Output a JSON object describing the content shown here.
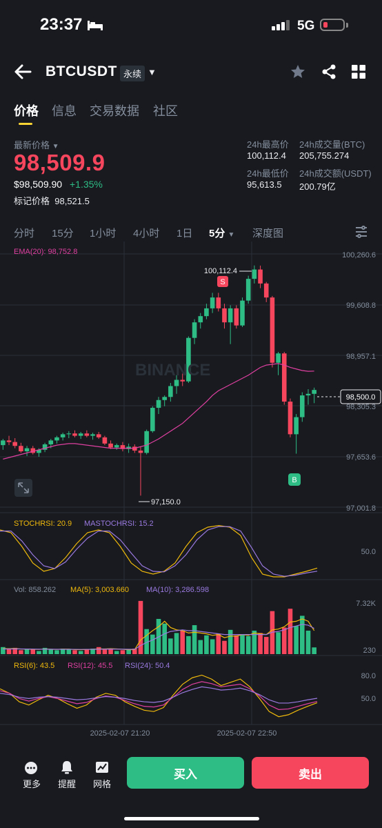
{
  "status_bar": {
    "time": "23:37",
    "network": "5G"
  },
  "header": {
    "symbol": "BTCUSDT",
    "badge": "永续"
  },
  "tabs": [
    "价格",
    "信息",
    "交易数据",
    "社区"
  ],
  "price_panel": {
    "latest_label": "最新价格",
    "last_price": "98,509.9",
    "usd_price": "$98,509.90",
    "change_pct": "+1.35%",
    "mark_label": "标记价格",
    "mark_price": "98,521.5",
    "stats": {
      "high_label": "24h最高价",
      "high_value": "100,112.4",
      "vol_btc_label": "24h成交量(BTC)",
      "vol_btc_value": "205,755.274",
      "low_label": "24h最低价",
      "low_value": "95,613.5",
      "vol_usdt_label": "24h成交额(USDT)",
      "vol_usdt_value": "200.79亿"
    }
  },
  "timeframes": [
    "分时",
    "15分",
    "1小时",
    "4小时",
    "1日",
    "5分",
    "深度图"
  ],
  "active_timeframe": "5分",
  "colors": {
    "up": "#2ebd85",
    "down": "#f6465d",
    "accent": "#fcd535",
    "ema": "#e040a0",
    "purple": "#9b7ae0",
    "yellow": "#f0b90b"
  },
  "chart_data": [
    {
      "type": "candlestick",
      "title": "EMA(20): 98,752.8",
      "watermark": "BINANCE",
      "y_axis_labels": [
        "100,260.6",
        "99,608.8",
        "98,957.1",
        "98,305.3",
        "97,653.6",
        "97,001.8"
      ],
      "ylim": [
        97001.8,
        100260.6
      ],
      "current_price_label": "98,500.0",
      "high_annotation": "100,112.4",
      "low_annotation": "97,150.0",
      "sell_marker": "S",
      "buy_marker": "B",
      "candles": [
        [
          97800,
          97880,
          97740,
          97860
        ],
        [
          97860,
          97920,
          97800,
          97840
        ],
        [
          97840,
          97890,
          97760,
          97790
        ],
        [
          97790,
          97830,
          97700,
          97720
        ],
        [
          97720,
          97790,
          97660,
          97760
        ],
        [
          97760,
          97790,
          97680,
          97700
        ],
        [
          97700,
          97760,
          97650,
          97740
        ],
        [
          97740,
          97830,
          97710,
          97810
        ],
        [
          97810,
          97880,
          97760,
          97860
        ],
        [
          97860,
          97920,
          97820,
          97900
        ],
        [
          97900,
          97960,
          97860,
          97940
        ],
        [
          97940,
          97980,
          97890,
          97950
        ],
        [
          97950,
          97990,
          97900,
          97920
        ],
        [
          97920,
          97970,
          97880,
          97950
        ],
        [
          97950,
          97990,
          97900,
          97920
        ],
        [
          97920,
          97960,
          97870,
          97940
        ],
        [
          97940,
          97970,
          97880,
          97900
        ],
        [
          97900,
          97920,
          97800,
          97820
        ],
        [
          97820,
          97860,
          97750,
          97770
        ],
        [
          97770,
          97820,
          97740,
          97800
        ],
        [
          97800,
          97840,
          97720,
          97750
        ],
        [
          97750,
          97820,
          97700,
          97780
        ],
        [
          97780,
          97810,
          97700,
          97730
        ],
        [
          97730,
          97780,
          97150,
          97700
        ],
        [
          97700,
          98000,
          97680,
          97980
        ],
        [
          97980,
          98300,
          97960,
          98280
        ],
        [
          98280,
          98420,
          98200,
          98380
        ],
        [
          98380,
          98440,
          98300,
          98420
        ],
        [
          98420,
          98600,
          98360,
          98560
        ],
        [
          98560,
          98700,
          98460,
          98640
        ],
        [
          98640,
          98720,
          98560,
          98620
        ],
        [
          98620,
          99200,
          98600,
          99180
        ],
        [
          99180,
          99420,
          99100,
          99380
        ],
        [
          99380,
          99500,
          99300,
          99460
        ],
        [
          99460,
          99620,
          99420,
          99560
        ],
        [
          99560,
          99760,
          99500,
          99700
        ],
        [
          99700,
          99760,
          99520,
          99560
        ],
        [
          99560,
          99620,
          99300,
          99380
        ],
        [
          99380,
          99600,
          99100,
          99560
        ],
        [
          99560,
          99600,
          99300,
          99340
        ],
        [
          99340,
          99700,
          99320,
          99660
        ],
        [
          99660,
          99980,
          99620,
          99940
        ],
        [
          99940,
          100112.4,
          99880,
          100060
        ],
        [
          100060,
          100110,
          99820,
          99880
        ],
        [
          99880,
          99900,
          99640,
          99700
        ],
        [
          99700,
          99720,
          98800,
          98860
        ],
        [
          98860,
          99000,
          98700,
          98980
        ],
        [
          98980,
          99000,
          98320,
          98360
        ],
        [
          98360,
          98400,
          97900,
          97940
        ],
        [
          97940,
          98200,
          97690,
          98160
        ],
        [
          98160,
          98480,
          98100,
          98440
        ],
        [
          98440,
          98520,
          98320,
          98460
        ],
        [
          98460,
          98540,
          98340,
          98510
        ]
      ],
      "ema_20": [
        97620,
        97640,
        97660,
        97680,
        97700,
        97720,
        97740,
        97760,
        97780,
        97800,
        97810,
        97820,
        97820,
        97810,
        97800,
        97790,
        97780,
        97770,
        97760,
        97760,
        97760,
        97760,
        97760,
        97780,
        97800,
        97840,
        97880,
        97930,
        97980,
        98030,
        98080,
        98150,
        98220,
        98290,
        98360,
        98440,
        98500,
        98540,
        98580,
        98620,
        98660,
        98700,
        98750,
        98800,
        98830,
        98840,
        98850,
        98830,
        98800,
        98780,
        98760,
        98750,
        98752.8
      ]
    },
    {
      "type": "line",
      "title": "STOCHRSI",
      "series": [
        {
          "name": "STOCHRSI: 20.9",
          "values": [
            90,
            85,
            60,
            30,
            15,
            20,
            40,
            65,
            85,
            90,
            85,
            60,
            30,
            15,
            10,
            15,
            30,
            60,
            85,
            95,
            98,
            95,
            80,
            40,
            10,
            5,
            5,
            10,
            15,
            20.9
          ]
        },
        {
          "name": "MASTOCHRSI: 15.2",
          "values": [
            88,
            88,
            70,
            45,
            25,
            20,
            32,
            55,
            75,
            88,
            88,
            72,
            48,
            25,
            15,
            14,
            25,
            45,
            72,
            90,
            96,
            96,
            88,
            58,
            25,
            10,
            6,
            8,
            12,
            15.2
          ]
        }
      ],
      "y_axis_labels": [
        "50.0"
      ],
      "ylim": [
        0,
        100
      ]
    },
    {
      "type": "bar",
      "title": "Vol",
      "vol_label": "Vol: 858.262",
      "series": [
        {
          "name": "MA(5): 3,003.660",
          "values": []
        },
        {
          "name": "MA(10): 3,286.598",
          "values": []
        }
      ],
      "y_axis_labels": [
        "7.32K",
        "230"
      ],
      "volumes": [
        900,
        700,
        800,
        500,
        700,
        600,
        400,
        800,
        600,
        500,
        700,
        600,
        500,
        400,
        600,
        700,
        900,
        600,
        700,
        400,
        500,
        600,
        700,
        6800,
        3200,
        2500,
        4500,
        3900,
        2000,
        2700,
        3000,
        2300,
        3700,
        1800,
        2400,
        1900,
        2600,
        1700,
        3100,
        2400,
        2500,
        2300,
        3000,
        2700,
        2200,
        5500,
        2800,
        3400,
        5800,
        3600,
        4900,
        3000,
        858.262
      ],
      "ma5": [
        700,
        700,
        720,
        650,
        650,
        620,
        600,
        650,
        620,
        600,
        640,
        640,
        580,
        560,
        600,
        620,
        660,
        660,
        700,
        660,
        620,
        560,
        580,
        1800,
        2400,
        3000,
        3500,
        4200,
        3400,
        3100,
        3000,
        2700,
        2800,
        2700,
        2600,
        2400,
        2500,
        2100,
        2300,
        2300,
        2500,
        2400,
        2700,
        2600,
        2500,
        3100,
        3200,
        3500,
        4100,
        4200,
        4500,
        4200,
        3003.66
      ],
      "ma10": [
        650,
        660,
        670,
        660,
        650,
        640,
        630,
        630,
        630,
        620,
        620,
        620,
        610,
        600,
        610,
        620,
        630,
        640,
        650,
        640,
        630,
        620,
        620,
        1100,
        1500,
        1800,
        2200,
        2600,
        2900,
        3000,
        3100,
        3000,
        3000,
        2900,
        2800,
        2700,
        2600,
        2500,
        2500,
        2500,
        2500,
        2500,
        2500,
        2500,
        2500,
        2800,
        2900,
        3100,
        3400,
        3600,
        3800,
        3700,
        3286.598
      ]
    },
    {
      "type": "line",
      "title": "RSI",
      "series": [
        {
          "name": "RSI(6): 43.5",
          "values": [
            65,
            58,
            45,
            40,
            48,
            55,
            50,
            42,
            35,
            40,
            52,
            58,
            55,
            45,
            38,
            32,
            30,
            36,
            55,
            72,
            82,
            86,
            80,
            70,
            75,
            80,
            68,
            50,
            30,
            22,
            25,
            32,
            38,
            43.5
          ]
        },
        {
          "name": "RSI(12): 45.5",
          "values": [
            62,
            58,
            50,
            46,
            50,
            53,
            50,
            46,
            42,
            44,
            50,
            54,
            52,
            47,
            42,
            38,
            37,
            40,
            52,
            64,
            72,
            76,
            73,
            68,
            70,
            72,
            65,
            54,
            40,
            33,
            34,
            38,
            42,
            45.5
          ]
        },
        {
          "name": "RSI(24): 50.4",
          "values": [
            58,
            56,
            52,
            50,
            52,
            53,
            52,
            50,
            48,
            49,
            51,
            53,
            52,
            50,
            47,
            45,
            44,
            46,
            52,
            59,
            64,
            68,
            66,
            63,
            64,
            66,
            62,
            56,
            48,
            43,
            43,
            45,
            48,
            50.4
          ]
        }
      ],
      "y_axis_labels": [
        "80.0",
        "50.0"
      ],
      "ylim": [
        10,
        95
      ]
    }
  ],
  "x_axis_labels": [
    "2025-02-07 21:20",
    "2025-02-07 22:50"
  ],
  "bottom_bar": {
    "more": "更多",
    "alert": "提醒",
    "grid": "网格",
    "buy": "买入",
    "sell": "卖出"
  }
}
